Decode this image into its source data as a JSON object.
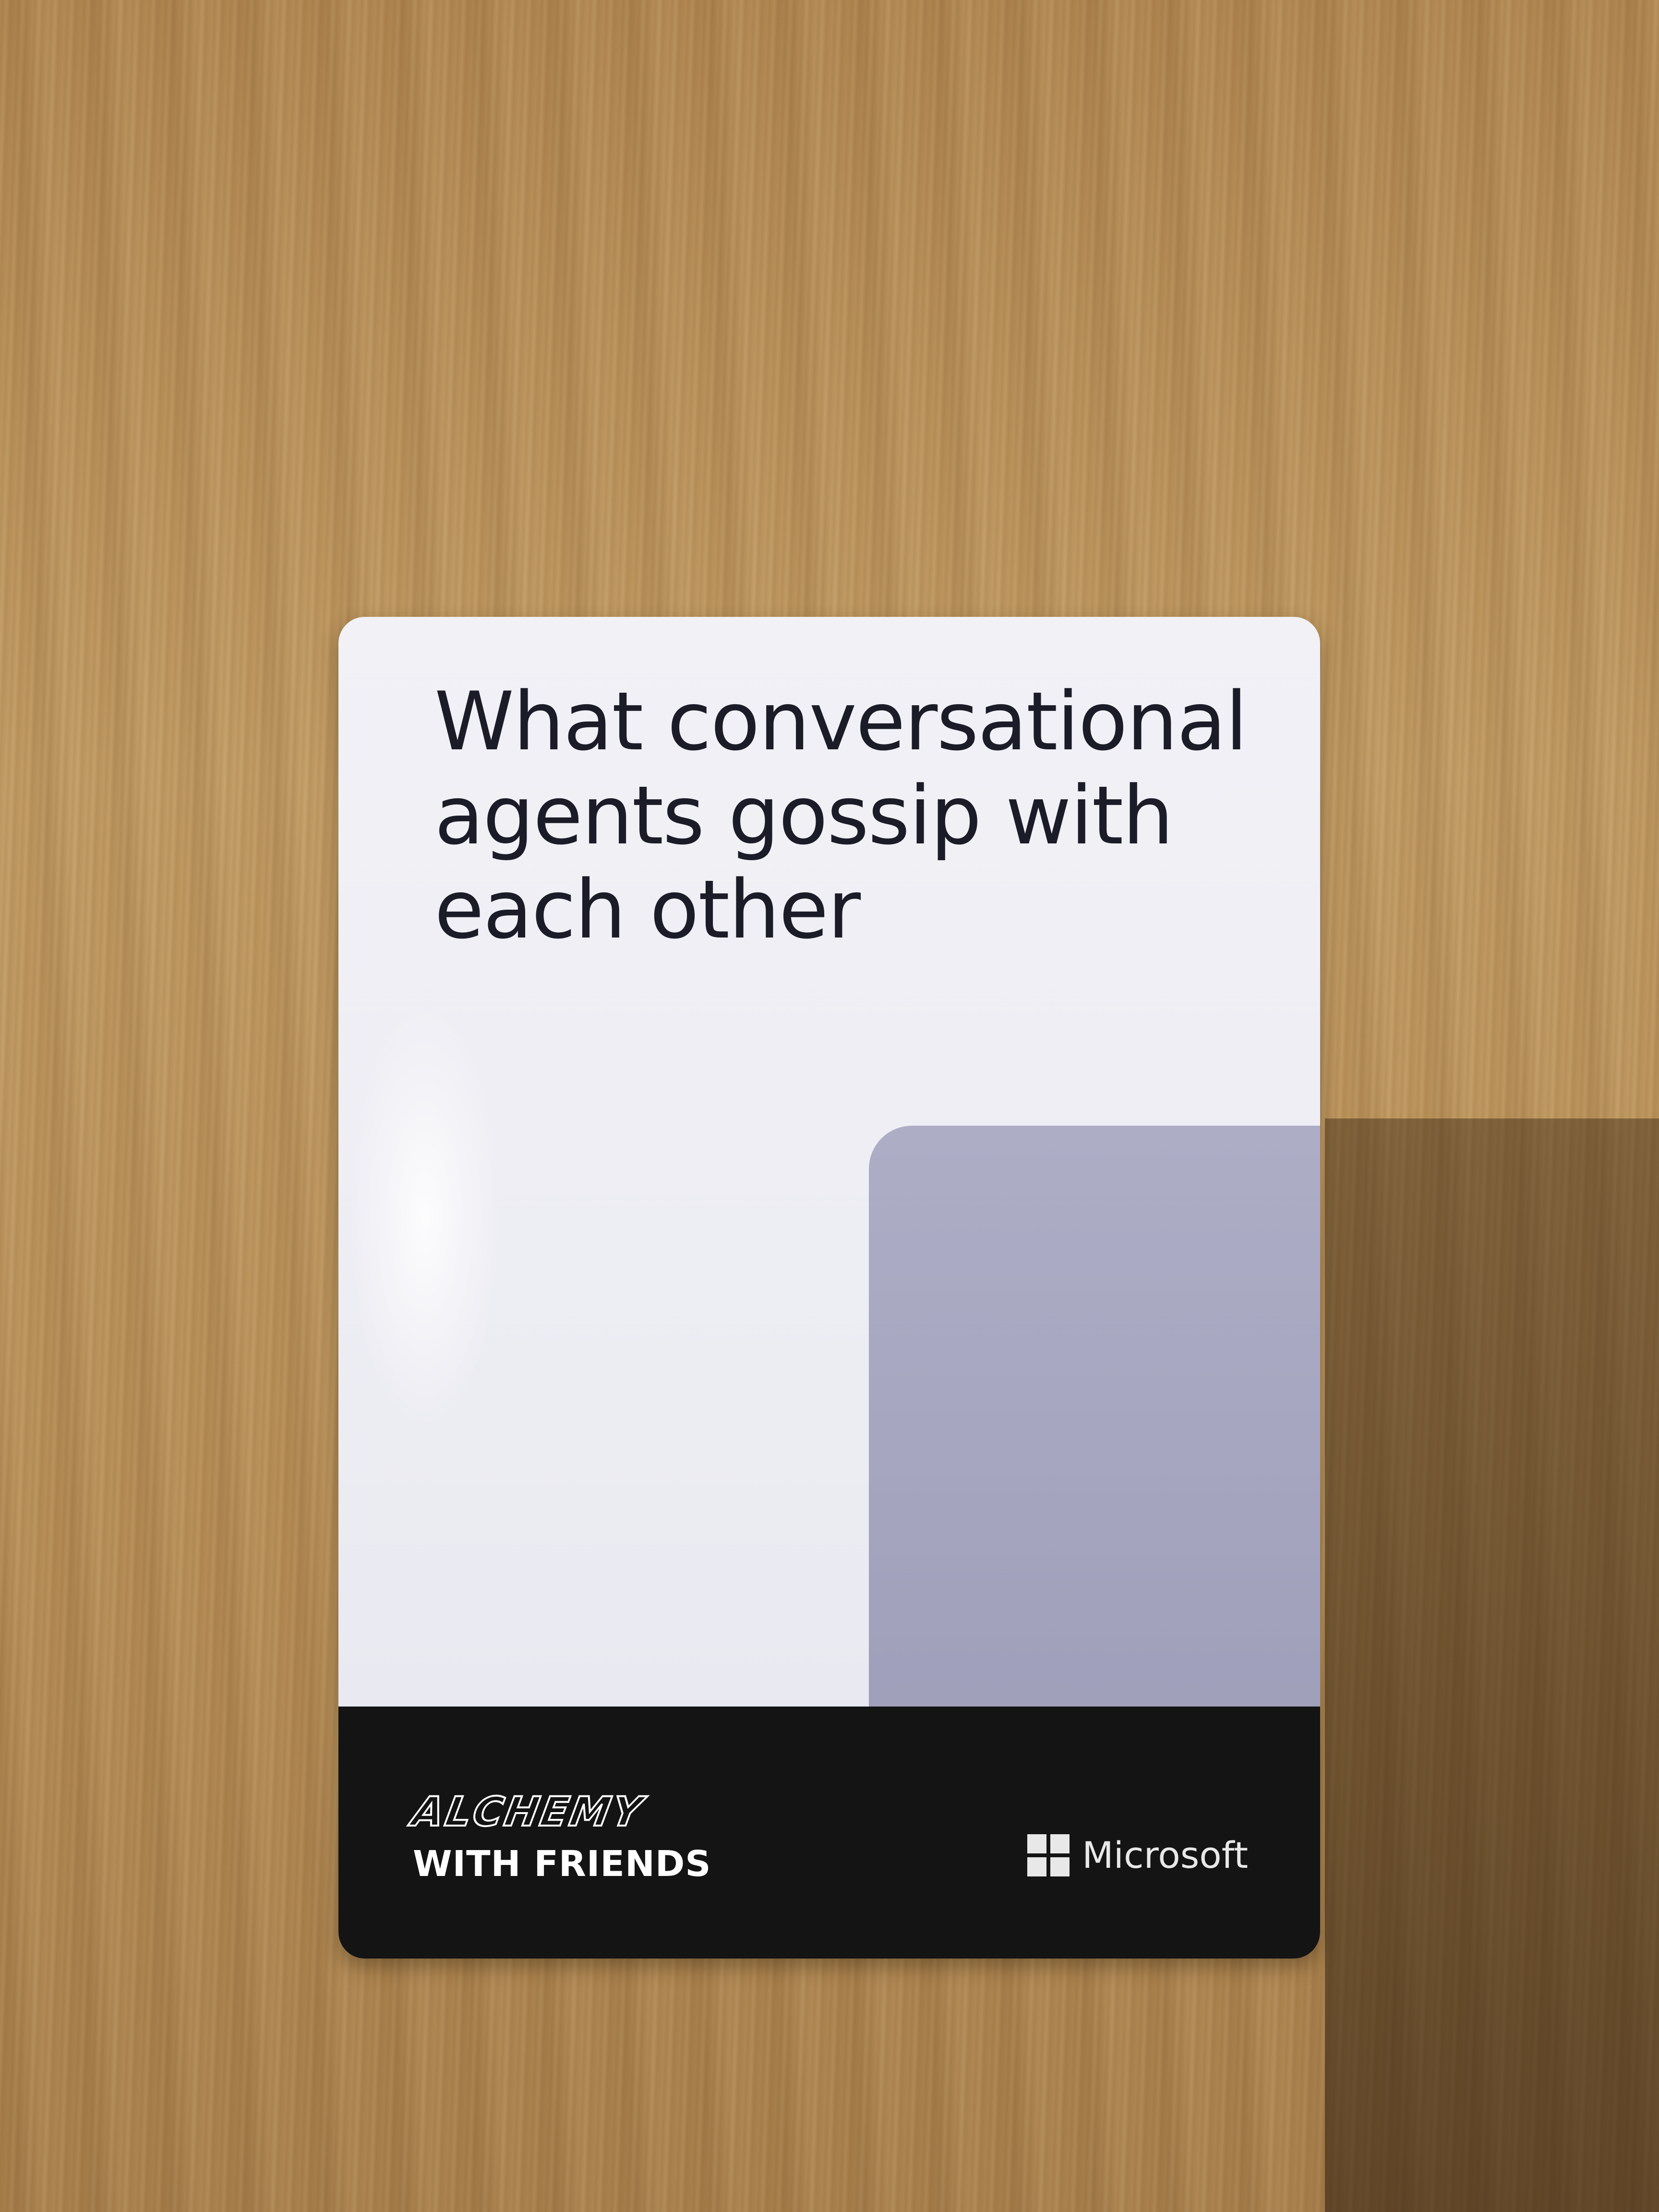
{
  "card": {
    "prompt_lines": [
      "What conversational",
      "agents gossip with",
      "each other"
    ]
  },
  "footer": {
    "logo_alchemy": "ALCHEMY",
    "logo_tagline": "WITH FRIENDS",
    "brand_icon": "microsoft-logo-icon",
    "brand_name": "Microsoft"
  }
}
